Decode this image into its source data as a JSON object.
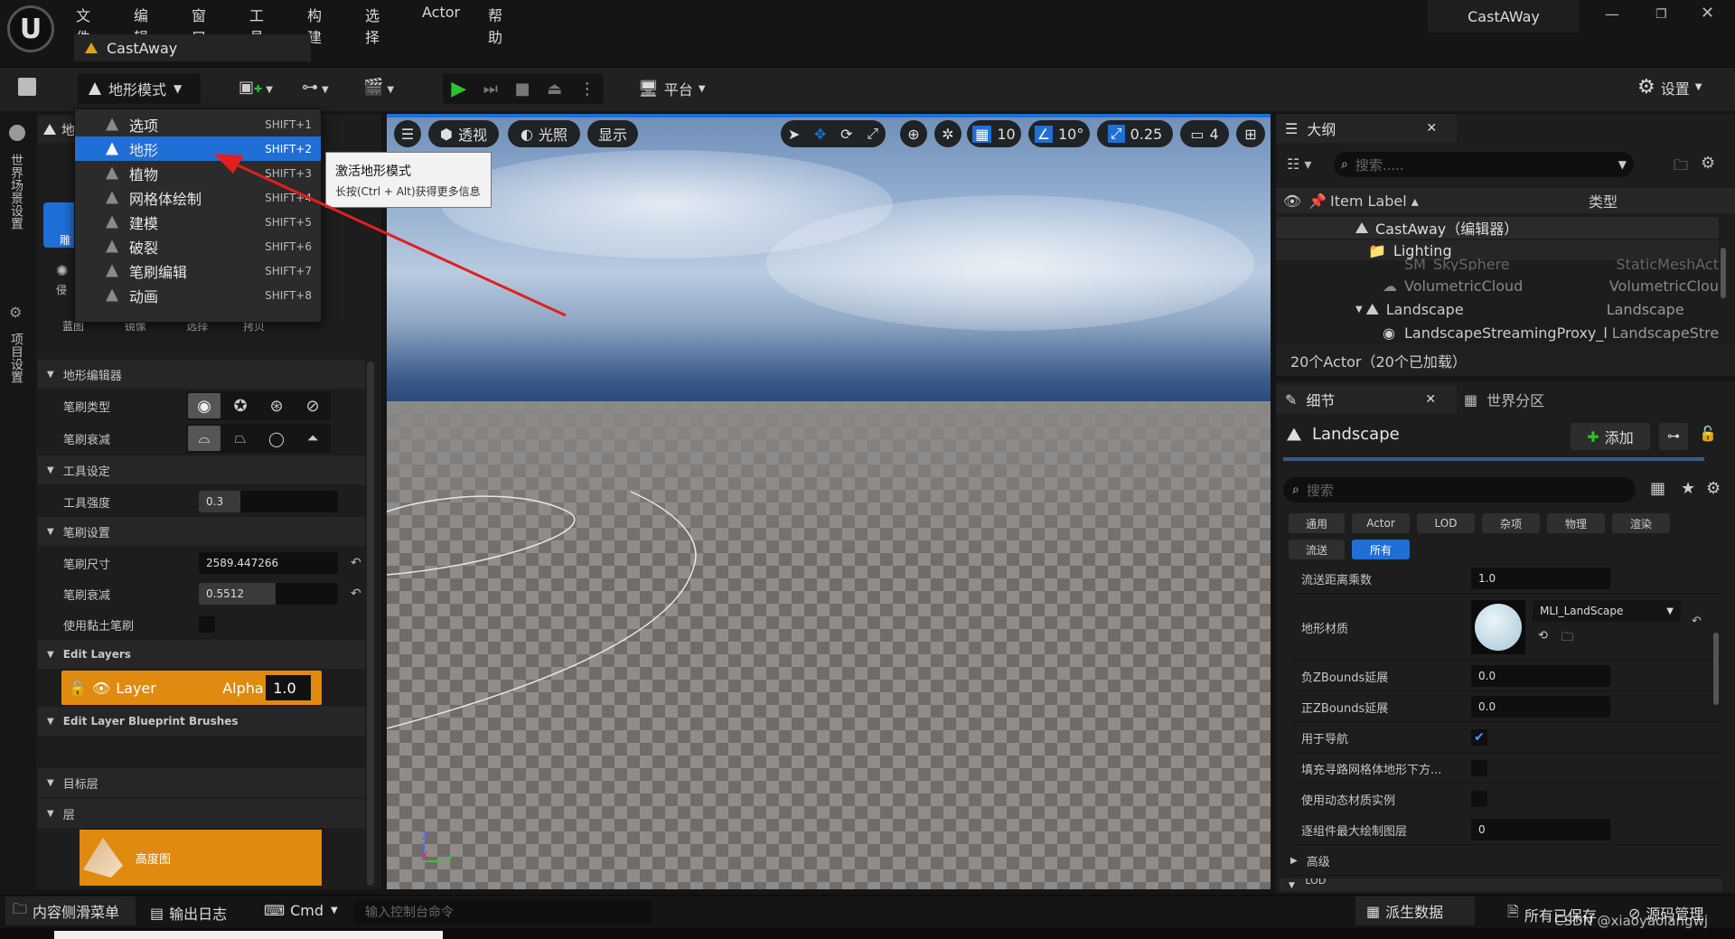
{
  "app": {
    "logo": "unreal-logo",
    "window_title": "CastAWay",
    "project_tab": "CastAway"
  },
  "menu": [
    "文件",
    "编辑",
    "窗口",
    "工具",
    "构建",
    "选择",
    "Actor",
    "帮助"
  ],
  "toolbar": {
    "mode_label": "地形模式",
    "platform_label": "平台",
    "settings_label": "设置"
  },
  "mode_menu": {
    "items": [
      {
        "label": "选项",
        "shortcut": "SHIFT+1"
      },
      {
        "label": "地形",
        "shortcut": "SHIFT+2"
      },
      {
        "label": "植物",
        "shortcut": "SHIFT+3"
      },
      {
        "label": "网格体绘制",
        "shortcut": "SHIFT+4"
      },
      {
        "label": "建模",
        "shortcut": "SHIFT+5"
      },
      {
        "label": "破裂",
        "shortcut": "SHIFT+6"
      },
      {
        "label": "笔刷编辑",
        "shortcut": "SHIFT+7"
      },
      {
        "label": "动画",
        "shortcut": "SHIFT+8"
      }
    ],
    "selected_index": 1
  },
  "tooltip": {
    "title": "激活地形模式",
    "body": "长按(Ctrl + Alt)获得更多信息"
  },
  "side_rail": {
    "world_settings": "世界场景设置",
    "project_settings": "项目设置"
  },
  "left_panel": {
    "tab_fragment": "地",
    "sculpt_fragment": "雕",
    "erode_fragment": "侵",
    "tools": [
      "蓝图",
      "镜像",
      "选择",
      "拷贝"
    ],
    "section_landscape_editor": "地形编辑器",
    "brush_type_label": "笔刷类型",
    "brush_falloff_label": "笔刷衰减",
    "section_tool_settings": "工具设定",
    "tool_strength_label": "工具强度",
    "tool_strength_value": "0.3",
    "tool_strength_fill": 0.3,
    "section_brush_settings": "笔刷设置",
    "brush_size_label": "笔刷尺寸",
    "brush_size_value": "2589.447266",
    "brush_falloff2_label": "笔刷衰减",
    "brush_falloff_value": "0.5512",
    "brush_falloff_fill": 0.5512,
    "use_clay_label": "使用黏土笔刷",
    "section_edit_layers": "Edit Layers",
    "layer_name": "Layer",
    "layer_alpha_label": "Alpha",
    "layer_alpha_value": "1.0",
    "section_blueprint_brushes": "Edit Layer Blueprint Brushes",
    "section_target_layers": "目标层",
    "section_layers": "层",
    "heightmap_label": "高度图"
  },
  "viewport": {
    "perspective": "透视",
    "lighting": "光照",
    "show": "显示",
    "grid_snap": "10",
    "rotation_snap": "10°",
    "scale_snap": "0.25",
    "camera_speed": "4",
    "axis_z": "Z",
    "axis_x": "X",
    "axis_y": "Y"
  },
  "outliner": {
    "title": "大纲",
    "search_placeholder": "搜索.....",
    "col_label": "Item Label",
    "col_type": "类型",
    "rows": [
      {
        "label": "CastAway（编辑器）",
        "type": ""
      },
      {
        "label": "Lighting",
        "type": ""
      },
      {
        "label": "SM_SkySphere",
        "type": "StaticMeshAct"
      },
      {
        "label": "VolumetricCloud",
        "type": "VolumetricClou"
      },
      {
        "label": "Landscape",
        "type": "Landscape"
      },
      {
        "label": "LandscapeStreamingProxy_l",
        "type": "LandscapeStre"
      }
    ],
    "footer": "20个Actor（20个已加载）"
  },
  "details": {
    "tab_details": "细节",
    "tab_world_partition": "世界分区",
    "actor_name": "Landscape",
    "add_label": "添加",
    "search_placeholder": "搜索",
    "filters": [
      "通用",
      "Actor",
      "LOD",
      "杂项",
      "物理",
      "渲染",
      "流送",
      "所有"
    ],
    "active_filter_index": 7,
    "streaming_distance_label": "流送距离乘数",
    "streaming_distance_value": "1.0",
    "material_label": "地形材质",
    "material_value": "MLI_LandScape",
    "neg_z_label": "负ZBounds延展",
    "neg_z_value": "0.0",
    "pos_z_label": "正ZBounds延展",
    "pos_z_value": "0.0",
    "navigation_label": "用于导航",
    "fill_nav_label": "填充寻路网格体地形下方...",
    "dynamic_mat_label": "使用动态材质实例",
    "max_paint_label": "逐组件最大绘制图层",
    "max_paint_value": "0",
    "advanced_label": "高级",
    "lod_fragment": "LOD"
  },
  "statusbar": {
    "content_drawer": "内容侧滑菜单",
    "output_log": "输出日志",
    "cmd": "Cmd",
    "console_placeholder": "输入控制台命令",
    "derived_data": "派生数据",
    "all_saved": "所有已保存",
    "source_control": "源码管理",
    "watermark": "CSDN @xiaoyaolangwj"
  },
  "colors": {
    "accent_blue": "#1f6fd6",
    "selection_orange": "#e08a10",
    "play_green": "#2fbf2f"
  }
}
